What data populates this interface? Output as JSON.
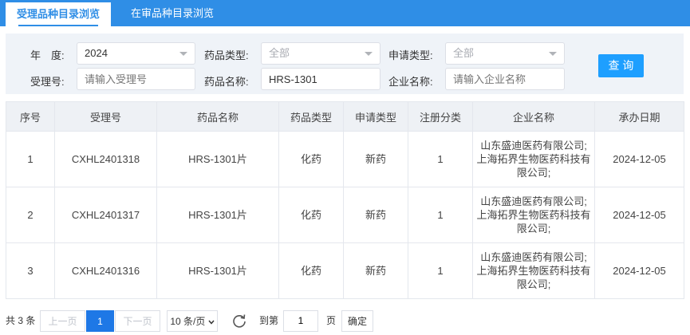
{
  "tabs": [
    {
      "label": "受理品种目录浏览"
    },
    {
      "label": "在审品种目录浏览"
    }
  ],
  "filters": {
    "year_label": "年　度:",
    "year_value": "2024",
    "drug_type_label": "药品类型:",
    "drug_type_value": "全部",
    "apply_type_label": "申请类型:",
    "apply_type_value": "全部",
    "accept_no_label": "受理号:",
    "accept_no_placeholder": "请输入受理号",
    "drug_name_label": "药品名称:",
    "drug_name_value": "HRS-1301",
    "company_label": "企业名称:",
    "company_placeholder": "请输入企业名称",
    "query_label": "查 询"
  },
  "table": {
    "headers": [
      "序号",
      "受理号",
      "药品名称",
      "药品类型",
      "申请类型",
      "注册分类",
      "企业名称",
      "承办日期"
    ],
    "rows": [
      [
        "1",
        "CXHL2401318",
        "HRS-1301片",
        "化药",
        "新药",
        "1",
        "山东盛迪医药有限公司;上海拓界生物医药科技有限公司;",
        "2024-12-05"
      ],
      [
        "2",
        "CXHL2401317",
        "HRS-1301片",
        "化药",
        "新药",
        "1",
        "山东盛迪医药有限公司;上海拓界生物医药科技有限公司;",
        "2024-12-05"
      ],
      [
        "3",
        "CXHL2401316",
        "HRS-1301片",
        "化药",
        "新药",
        "1",
        "山东盛迪医药有限公司;上海拓界生物医药科技有限公司;",
        "2024-12-05"
      ]
    ]
  },
  "pager": {
    "total": "共 3 条",
    "prev": "上一页",
    "current": "1",
    "next": "下一页",
    "page_size": "10 条/页",
    "goto_label": "到第",
    "goto_value": "1",
    "page_unit": "页",
    "confirm": "确定"
  },
  "colors": {
    "accent": "#2f8ee6",
    "button": "#1e9fff",
    "current_page": "#1e78e6",
    "filter_bg": "#eff3f8",
    "header_bg": "#eef1f5"
  },
  "icons": {
    "refresh": "refresh-icon",
    "dropdown": "chevron-down-icon"
  }
}
